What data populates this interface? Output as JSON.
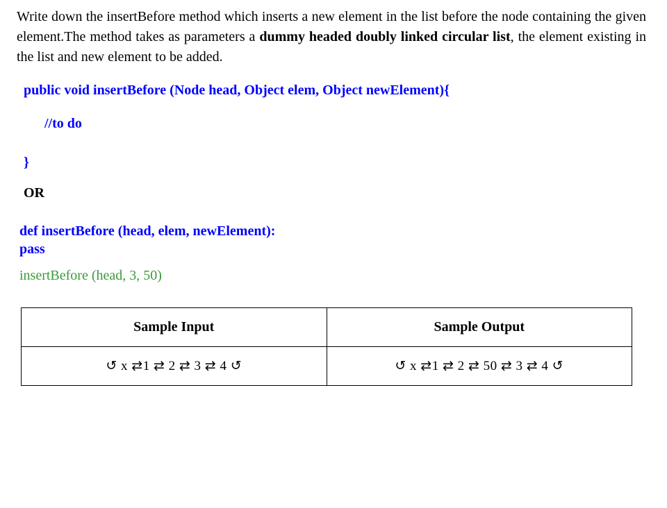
{
  "problem": {
    "segments": [
      {
        "text": "Write down the insertBefore method which inserts a new element in the list before the node containing the given element.The method takes as parameters a ",
        "bold": false
      },
      {
        "text": "dummy headed doubly linked circular list",
        "bold": true
      },
      {
        "text": ", the element existing in the list and new element to be added.",
        "bold": false
      }
    ]
  },
  "java": {
    "signature": "public void insertBefore (Node head, Object elem, Object newElement){",
    "todo": "//to do",
    "closing": "}"
  },
  "or_label": "OR",
  "python": {
    "signature": "def insertBefore (head, elem, newElement):",
    "body": "pass"
  },
  "call_example": "insertBefore (head, 3, 50)",
  "table": {
    "headers": [
      "Sample Input",
      "Sample Output"
    ],
    "rows": [
      [
        "↺ x ⇄1 ⇄ 2 ⇄ 3 ⇄ 4 ↺",
        "↺ x ⇄1 ⇄ 2 ⇄ 50 ⇄ 3 ⇄ 4 ↺"
      ]
    ]
  }
}
